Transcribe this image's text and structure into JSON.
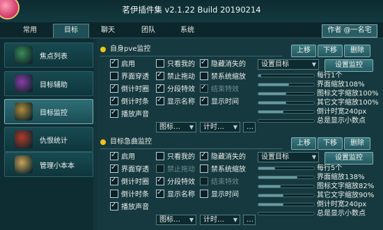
{
  "window": {
    "title": "茗伊插件集 v2.1.22 Build 20190214"
  },
  "tabs": [
    {
      "label": "常用",
      "active": false
    },
    {
      "label": "目标",
      "active": true
    },
    {
      "label": "聊天",
      "active": false
    },
    {
      "label": "团队",
      "active": false
    },
    {
      "label": "系统",
      "active": false
    }
  ],
  "author_button": "作者 @一名宅",
  "sidebar": {
    "items": [
      {
        "label": "焦点列表",
        "icon": "jade-badge-icon",
        "color": "#3b8a58",
        "active": false
      },
      {
        "label": "目标辅助",
        "icon": "purple-flame-icon",
        "color": "#8a3ba8",
        "active": false
      },
      {
        "label": "目标监控",
        "icon": "warrior-portrait-icon",
        "color": "#b08a3a",
        "active": true
      },
      {
        "label": "仇恨统计",
        "icon": "red-mask-icon",
        "color": "#b23a2a",
        "active": false
      },
      {
        "label": "管理小本本",
        "icon": "book-icon",
        "color": "#c9a35a",
        "active": false
      }
    ]
  },
  "panels": [
    {
      "title": "自身pve监控",
      "buttons": {
        "up": "上移",
        "down": "下移",
        "delete": "删除"
      },
      "settings_button": "设置监控",
      "target_select": "设置目标",
      "checkboxes": [
        {
          "label": "启用",
          "checked": true,
          "disabled": false
        },
        {
          "label": "只看我的",
          "checked": false,
          "disabled": false
        },
        {
          "label": "隐藏消失的",
          "checked": true,
          "disabled": false
        },
        {
          "label": "界面穿透",
          "checked": false,
          "disabled": false
        },
        {
          "label": "禁止拖动",
          "checked": true,
          "disabled": false
        },
        {
          "label": "禁系统缩放",
          "checked": false,
          "disabled": false
        },
        {
          "label": "倒计时圈",
          "checked": true,
          "disabled": false
        },
        {
          "label": "分段特效",
          "checked": true,
          "disabled": false
        },
        {
          "label": "结束特效",
          "checked": true,
          "disabled": true
        },
        {
          "label": "倒计时条",
          "checked": true,
          "disabled": false
        },
        {
          "label": "显示名称",
          "checked": true,
          "disabled": false
        },
        {
          "label": "显示时间",
          "checked": true,
          "disabled": false
        },
        {
          "label": "播放声音",
          "checked": true,
          "disabled": false
        }
      ],
      "selects": [
        "图标…",
        "计时…",
        "…"
      ],
      "sliders": [
        {
          "label": "每行1个",
          "value": 0.05
        },
        {
          "label": "界面缩放108%",
          "value": 0.55
        },
        {
          "label": "图标文字缩放100%",
          "value": 0.5
        },
        {
          "label": "其它文字缩放100%",
          "value": 0.5
        },
        {
          "label": "倒计时宽240px",
          "value": 0.45
        },
        {
          "label": "总是显示小数点",
          "value": 0.0
        }
      ]
    },
    {
      "title": "目标急曲监控",
      "buttons": {
        "up": "上移",
        "down": "下移",
        "delete": "删除"
      },
      "settings_button": "设置监控",
      "target_select": "设置目标",
      "checkboxes": [
        {
          "label": "启用",
          "checked": true,
          "disabled": false
        },
        {
          "label": "只看我的",
          "checked": false,
          "disabled": false
        },
        {
          "label": "隐藏消失的",
          "checked": true,
          "disabled": false
        },
        {
          "label": "界面穿透",
          "checked": true,
          "disabled": false
        },
        {
          "label": "禁止拖动",
          "checked": false,
          "disabled": true
        },
        {
          "label": "禁系统缩放",
          "checked": false,
          "disabled": false
        },
        {
          "label": "倒计时圈",
          "checked": true,
          "disabled": false
        },
        {
          "label": "分段特效",
          "checked": true,
          "disabled": false
        },
        {
          "label": "结束特效",
          "checked": false,
          "disabled": true
        },
        {
          "label": "倒计时条",
          "checked": false,
          "disabled": false
        },
        {
          "label": "显示名称",
          "checked": true,
          "disabled": false
        },
        {
          "label": "显示时间",
          "checked": false,
          "disabled": false
        },
        {
          "label": "播放声音",
          "checked": true,
          "disabled": false
        }
      ],
      "selects": [
        "图标…",
        "计时…",
        "…"
      ],
      "sliders": [
        {
          "label": "每行5个",
          "value": 0.3
        },
        {
          "label": "界面缩放138%",
          "value": 0.7
        },
        {
          "label": "图标文字缩放82%",
          "value": 0.4
        },
        {
          "label": "其它文字缩放90%",
          "value": 0.45
        },
        {
          "label": "倒计时宽240px",
          "value": 0.45
        },
        {
          "label": "总是显示小数点",
          "value": 0.0
        }
      ]
    }
  ]
}
